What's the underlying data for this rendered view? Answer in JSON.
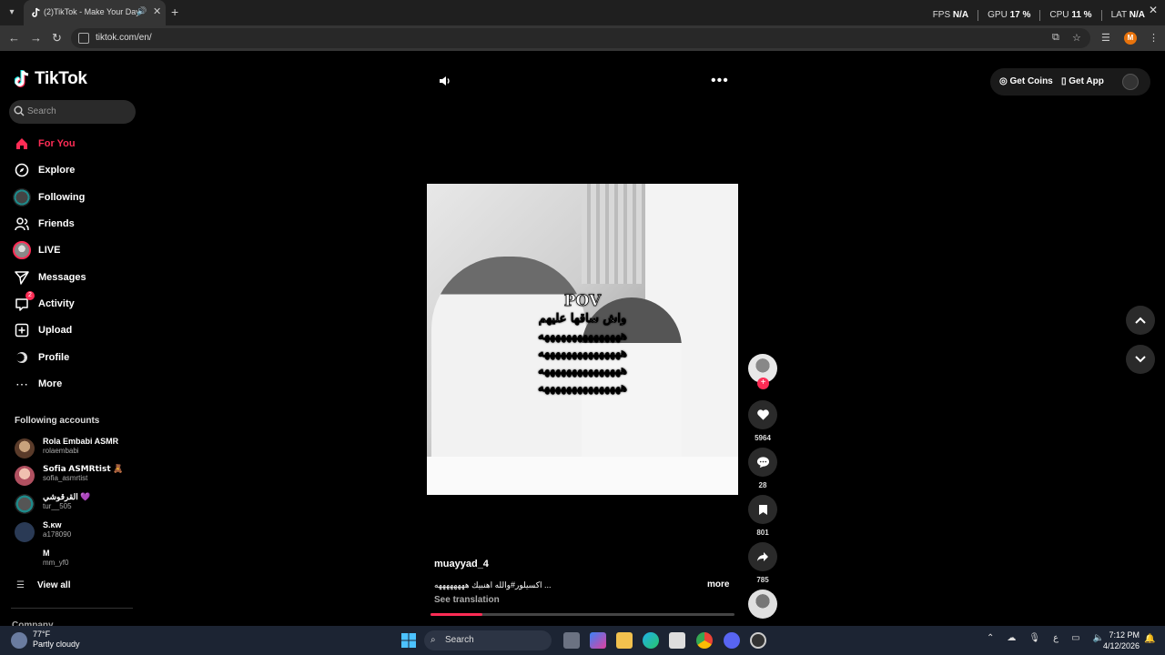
{
  "browser": {
    "tab_title": "(2)TikTok - Make Your Day",
    "url": "tiktok.com/en/",
    "profile_initial": "M",
    "perf": [
      {
        "label": "FPS",
        "value": "N/A"
      },
      {
        "label": "GPU",
        "value": "17 %"
      },
      {
        "label": "CPU",
        "value": "11 %"
      },
      {
        "label": "LAT",
        "value": "N/A"
      }
    ]
  },
  "brand": {
    "name": "TikTok"
  },
  "search": {
    "placeholder": "Search"
  },
  "nav": [
    {
      "label": "For You",
      "icon": "home-icon",
      "active": true
    },
    {
      "label": "Explore",
      "icon": "compass-icon"
    },
    {
      "label": "Following",
      "icon": "following-avatar-icon"
    },
    {
      "label": "Friends",
      "icon": "friends-icon"
    },
    {
      "label": "LIVE",
      "icon": "live-icon"
    },
    {
      "label": "Messages",
      "icon": "paper-plane-icon"
    },
    {
      "label": "Activity",
      "icon": "inbox-icon",
      "badge": "2"
    },
    {
      "label": "Upload",
      "icon": "plus-square-icon"
    },
    {
      "label": "Profile",
      "icon": "profile-avatar-icon"
    },
    {
      "label": "More",
      "icon": "ellipsis-icon"
    }
  ],
  "following_heading": "Following accounts",
  "following_accounts": [
    {
      "name": "Rola Embabi ASMR",
      "user": "rolaembabi"
    },
    {
      "name": "𝗦𝗼𝗳𝗶𝗮 𝗔𝗦𝗠𝗥𝘁𝗶𝘀𝘁 🧸",
      "user": "sofia_asmrtist"
    },
    {
      "name": "القرقوشي 💜",
      "user": "tur__505"
    },
    {
      "name": "S.ĸᴡ",
      "user": "a178090"
    },
    {
      "name": "M",
      "user": "mm_yf0"
    }
  ],
  "view_all": "View all",
  "company": "Company",
  "top_actions": {
    "coins": "Get Coins",
    "app": "Get App"
  },
  "video": {
    "overlay_title": "POV",
    "overlay_lines": [
      "واش ساقها عليهم",
      "هههههههههههههههه",
      "هههههههههههههههه",
      "هههههههههههههههه",
      "هههههههههههههههه"
    ],
    "progress": 0.17
  },
  "actions": {
    "likes": "5964",
    "comments": "28",
    "saves": "801",
    "shares": "785"
  },
  "post": {
    "author": "muayyad_4",
    "description": "اكسيلور#والله اهنبيك ههههههههه ...",
    "more": "more",
    "see_translation": "See translation"
  },
  "taskbar": {
    "temp": "77°F",
    "condition": "Partly cloudy",
    "search": "Search",
    "time": "7:12 PM",
    "date": "4/12/2026",
    "lang": "ع"
  }
}
